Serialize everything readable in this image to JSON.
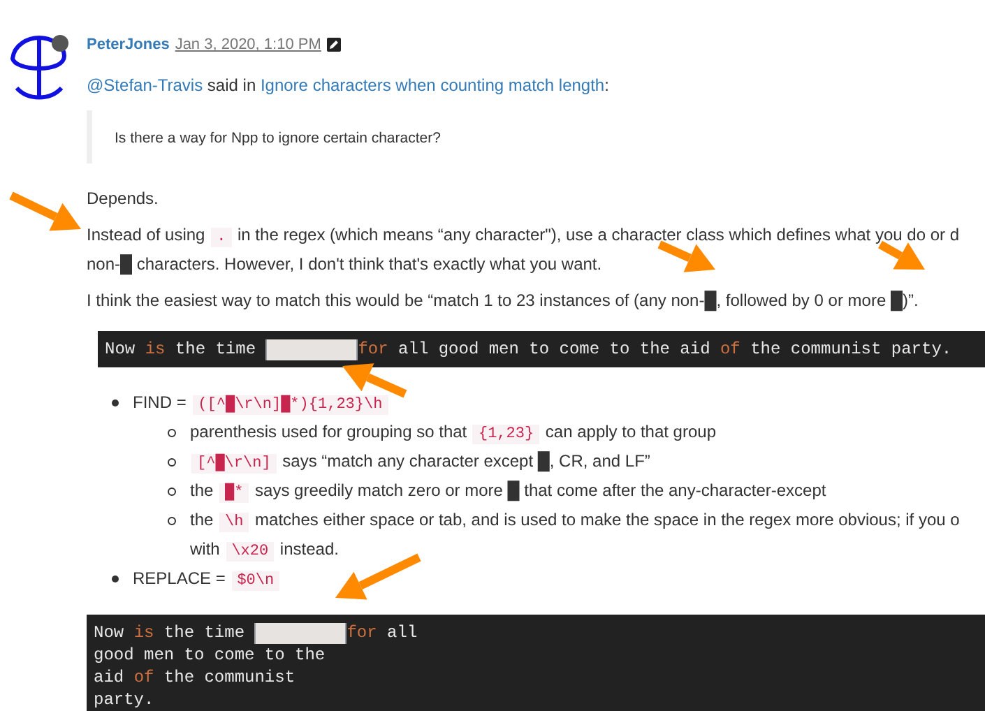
{
  "post": {
    "author": "PeterJones",
    "timestamp": "Jan 3, 2020, 1:10 PM",
    "edited": true,
    "online": true
  },
  "quote_intro": [
    {
      "kind": "link",
      "text": "@Stefan-Travis"
    },
    {
      "kind": "text",
      "text": " said in "
    },
    {
      "kind": "link",
      "text": "Ignore characters when counting match length"
    },
    {
      "kind": "text",
      "text": ":"
    }
  ],
  "quote": "Is there a way for Npp to ignore certain character?",
  "paragraphs": [
    {
      "lines": [
        [
          {
            "kind": "text",
            "text": "Depends."
          }
        ]
      ]
    },
    {
      "lines": [
        [
          {
            "kind": "text",
            "text": "Instead of using "
          },
          {
            "kind": "code",
            "text": "."
          },
          {
            "kind": "text",
            "text": " in the regex (which means “any character\"), use a character class which defines what you do or d"
          }
        ],
        [
          {
            "kind": "text",
            "text": "non-█ characters. However, I don't think that's exactly what you want."
          }
        ]
      ]
    },
    {
      "lines": [
        [
          {
            "kind": "text",
            "text": "I think the easiest way to match this would be “match 1 to 23 instances of (any non-█, followed by 0 or more █)”."
          }
        ]
      ]
    }
  ],
  "code_block_1": [
    [
      {
        "kind": "plain",
        "text": "Now "
      },
      {
        "kind": "keyword",
        "text": "is"
      },
      {
        "kind": "plain",
        "text": " the time "
      },
      {
        "kind": "selection"
      },
      {
        "kind": "keyword",
        "text": "for"
      },
      {
        "kind": "plain",
        "text": " all good men to come to the aid "
      },
      {
        "kind": "keyword",
        "text": "of"
      },
      {
        "kind": "plain",
        "text": " the communist party."
      }
    ]
  ],
  "list": [
    {
      "segments": [
        {
          "kind": "text",
          "text": "FIND = "
        },
        {
          "kind": "code",
          "text": "([^█\\r\\n]█*){1,23}\\h"
        }
      ],
      "children": [
        {
          "segments": [
            {
              "kind": "text",
              "text": "parenthesis used for grouping so that "
            },
            {
              "kind": "code",
              "text": "{1,23}"
            },
            {
              "kind": "text",
              "text": " can apply to that group"
            }
          ]
        },
        {
          "segments": [
            {
              "kind": "code",
              "text": "[^█\\r\\n]"
            },
            {
              "kind": "text",
              "text": " says “match any character except █, CR, and LF”"
            }
          ]
        },
        {
          "segments": [
            {
              "kind": "text",
              "text": "the "
            },
            {
              "kind": "code",
              "text": "█*"
            },
            {
              "kind": "text",
              "text": " says greedily match zero or more █ that come after the any-character-except"
            }
          ]
        },
        {
          "segments": [
            {
              "kind": "text",
              "text": "the "
            },
            {
              "kind": "code",
              "text": "\\h"
            },
            {
              "kind": "text",
              "text": " matches either space or tab, and is used to make the space in the regex more obvious; if you o"
            },
            {
              "kind": "break"
            },
            {
              "kind": "text",
              "text": "with "
            },
            {
              "kind": "code",
              "text": "\\x20"
            },
            {
              "kind": "text",
              "text": " instead."
            }
          ]
        }
      ]
    },
    {
      "segments": [
        {
          "kind": "text",
          "text": "REPLACE = "
        },
        {
          "kind": "code",
          "text": "$0\\n"
        }
      ]
    }
  ],
  "code_block_2": [
    [
      {
        "kind": "plain",
        "text": "Now "
      },
      {
        "kind": "keyword",
        "text": "is"
      },
      {
        "kind": "plain",
        "text": " the time "
      },
      {
        "kind": "selection"
      },
      {
        "kind": "keyword",
        "text": "for"
      },
      {
        "kind": "plain",
        "text": " all"
      }
    ],
    [
      {
        "kind": "plain",
        "text": "good men to come to the"
      }
    ],
    [
      {
        "kind": "plain",
        "text": "aid "
      },
      {
        "kind": "keyword",
        "text": "of"
      },
      {
        "kind": "plain",
        "text": " the communist"
      }
    ],
    [
      {
        "kind": "plain",
        "text": "party."
      }
    ]
  ]
}
